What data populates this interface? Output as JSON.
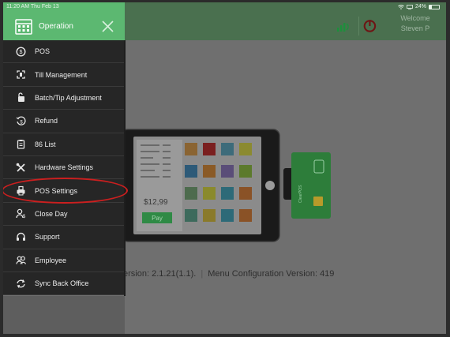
{
  "status_bar": {
    "time": "11:20 AM  Thu Feb 13",
    "battery": "24%",
    "battery_level": 0.24
  },
  "header": {
    "welcome": "Welcome",
    "user": "Steven P"
  },
  "drawer": {
    "title": "Operation",
    "items": [
      {
        "label": "POS",
        "icon": "pos-icon"
      },
      {
        "label": "Till Management",
        "icon": "till-icon"
      },
      {
        "label": "Batch/Tip Adjustment",
        "icon": "batch-icon"
      },
      {
        "label": "Refund",
        "icon": "refund-icon"
      },
      {
        "label": "86 List",
        "icon": "clipboard-icon"
      },
      {
        "label": "Hardware Settings",
        "icon": "tools-icon"
      },
      {
        "label": "POS Settings",
        "icon": "printer-icon"
      },
      {
        "label": "Close Day",
        "icon": "close-day-icon"
      },
      {
        "label": "Support",
        "icon": "headset-icon"
      },
      {
        "label": "Employee",
        "icon": "employee-icon"
      },
      {
        "label": "Sync Back Office",
        "icon": "sync-icon"
      }
    ]
  },
  "illustration": {
    "price": "$12,99",
    "pay_label": "Pay",
    "card_text": "ClearPOS"
  },
  "main": {
    "app_version": "ersion: 2.1.21(1.1).",
    "menu_version": "Menu Configuration Version: 419"
  },
  "colors": {
    "brand_green": "#5cb871",
    "header_green": "#4a704f",
    "drawer_bg": "#262626",
    "highlight": "#cc1f1f"
  }
}
